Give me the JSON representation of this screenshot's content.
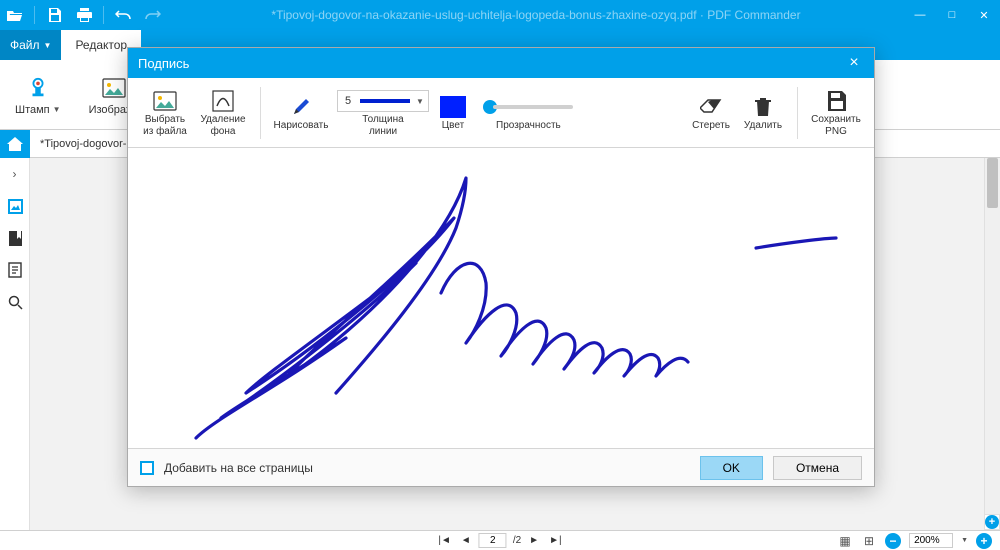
{
  "window": {
    "title": "*Tipovoj-dogovor-na-okazanie-uslug-uchitelja-logopeda-bonus-zhaxine-ozyq.pdf · PDF Commander",
    "doc_tab": "*Tipovoj-dogovor-na-ok…"
  },
  "menu": {
    "file": "Файл",
    "editor": "Редактор"
  },
  "ribbon": {
    "stamp": "Штамп",
    "image_partial": "Изображе"
  },
  "pager": {
    "page": "2",
    "total": "/2"
  },
  "zoom": {
    "value": "200%"
  },
  "modal": {
    "title": "Подпись",
    "tools": {
      "from_file": "Выбрать из файла",
      "remove_bg": "Удаление фона",
      "draw": "Нарисовать",
      "thickness_label": "Толщина линии",
      "thickness_value": "5",
      "color": "Цвет",
      "opacity": "Прозрачность",
      "erase": "Стереть",
      "delete": "Удалить",
      "save_png": "Сохранить PNG"
    },
    "footer": {
      "apply_all": "Добавить на все страницы",
      "ok": "OK",
      "cancel": "Отмена"
    }
  },
  "colors": {
    "accent": "#00a0e9",
    "ink": "#1a17b5",
    "color_swatch": "#0020ff"
  }
}
